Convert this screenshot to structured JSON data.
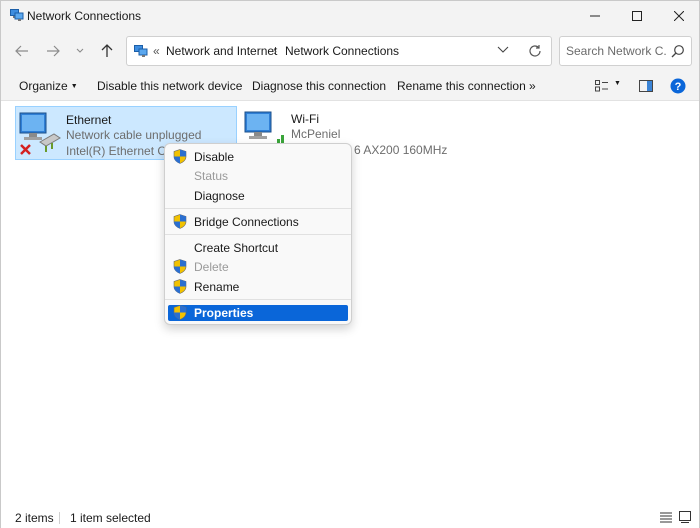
{
  "window": {
    "title": "Network Connections",
    "buttons": {
      "minimize": "minimize-icon",
      "maximize": "maximize-icon",
      "close": "close-icon"
    }
  },
  "nav": {
    "breadcrumb_prefix": "«",
    "breadcrumb": [
      "Network and Internet",
      "Network Connections"
    ],
    "breadcrumb_separator": "›",
    "search_placeholder": "Search Network C..."
  },
  "commands": {
    "organize": "Organize",
    "disable_device": "Disable this network device",
    "diagnose": "Diagnose this connection",
    "rename": "Rename this connection",
    "more": "»"
  },
  "connections": [
    {
      "name": "Ethernet",
      "status": "Network cable unplugged",
      "device": "Intel(R) Ethernet Conn",
      "selected": true
    },
    {
      "name": "Wi-Fi",
      "status": "McPeniel",
      "device": "6 AX200 160MHz",
      "selected": false
    }
  ],
  "context_menu": {
    "items": [
      {
        "label": "Disable",
        "shield": true,
        "disabled": false
      },
      {
        "label": "Status",
        "shield": false,
        "disabled": true
      },
      {
        "label": "Diagnose",
        "shield": false,
        "disabled": false
      },
      {
        "label": "Bridge Connections",
        "shield": true,
        "disabled": false
      },
      {
        "label": "Create Shortcut",
        "shield": false,
        "disabled": false
      },
      {
        "label": "Delete",
        "shield": true,
        "disabled": true
      },
      {
        "label": "Rename",
        "shield": true,
        "disabled": false
      },
      {
        "label": "Properties",
        "shield": true,
        "disabled": false,
        "highlighted": true
      }
    ]
  },
  "status": {
    "items_count": "2 items",
    "selected_count": "1 item selected"
  },
  "colors": {
    "selection": "#cce8ff",
    "menu_highlight": "#0a66d9",
    "help": "#0a66d9"
  }
}
